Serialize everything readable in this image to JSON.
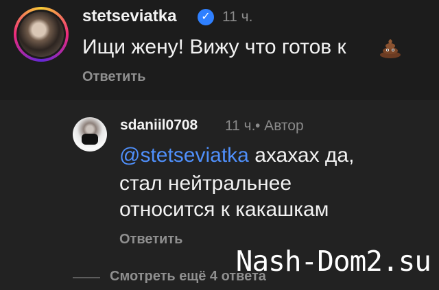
{
  "comment": {
    "username": "stetseviatka",
    "verified_icon": "verified-badge-icon",
    "time": "11 ч.",
    "text": "Ищи жену! Вижу что готов к",
    "emoji": "poop-emoji-icon",
    "reply_label": "Ответить"
  },
  "reply": {
    "username": "sdaniil0708",
    "time": "11 ч.",
    "author_label": "• Автор",
    "mention": "@stetseviatka",
    "line1_rest": " ахахах да,",
    "line2": "стал нейтральнее",
    "line3": "относится к какашкам",
    "reply_label": "Ответить"
  },
  "more_replies_label": "Смотреть ещё 4 ответа",
  "watermark": "Nash-Dom2.su",
  "colors": {
    "background": "#1b1b1b",
    "mention": "#4f8ffa",
    "muted": "#8b8b8b",
    "verified": "#2f80ff"
  }
}
